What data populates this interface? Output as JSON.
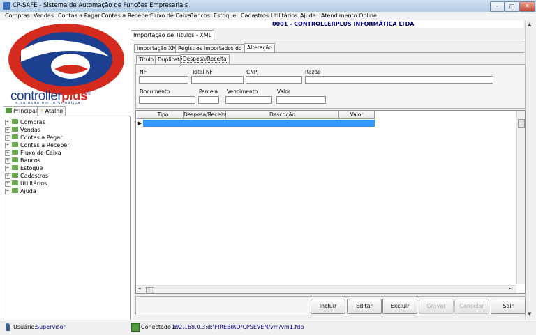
{
  "window": {
    "title": "CP-SAFE  -  Sistema de Automação de Funções Empresariais",
    "min": "–",
    "max": "▢",
    "close": "✕"
  },
  "menu": [
    "Compras",
    "Vendas",
    "Contas a Pagar",
    "Contas a Receber",
    "Fluxo de Caixa",
    "Bancos",
    "Estoque",
    "Cadastros",
    "Utilitários",
    "Ajuda",
    "Atendimento Online"
  ],
  "company": "0001 - CONTROLLERPLUS INFORMÁTICA LTDA",
  "logo": {
    "brand_a": "controller",
    "brand_b": "plus",
    "registered": "®",
    "tagline": "a solução em informática"
  },
  "nav_tabs": {
    "principal": "Principal",
    "atalho": "Atalho"
  },
  "tree": [
    "Compras",
    "Vendas",
    "Contas a Pagar",
    "Contas a Receber",
    "Fluxo de Caixa",
    "Bancos",
    "Estoque",
    "Cadastros",
    "Utilitários",
    "Ajuda"
  ],
  "doc_tab": "Importação de Títulos - XML",
  "tabs_level1": [
    "Importação XML",
    "Registros Importados do XML",
    "Alteração"
  ],
  "tabs_level2": [
    "Título",
    "Duplicata",
    "Despesa/Receita"
  ],
  "form": {
    "nf": "NF",
    "total_nf": "Total NF",
    "cnpj": "CNPJ",
    "razao": "Razão",
    "documento": "Documento",
    "parcela": "Parcela",
    "vencimento": "Vencimento",
    "valor": "Valor"
  },
  "grid": {
    "columns": [
      "Tipo",
      "Despesa/Receita",
      "Descrição",
      "Valor"
    ],
    "row_marker": "▶"
  },
  "buttons": {
    "incluir": "Incluir",
    "editar": "Editar",
    "excluir": "Excluir",
    "gravar": "Gravar",
    "cancelar": "Cancelar",
    "sair": "Sair"
  },
  "status": {
    "user_label": "Usuário:",
    "user": "Supervisor",
    "conn_label": "Conectado à",
    "conn": "192.168.0.3:d:\\FIREBIRD/CPSEVEN/vm/vm1.fdb"
  },
  "colors": {
    "selection": "#3399ff",
    "company_text": "#000080",
    "logo_red": "#d52b1e",
    "logo_blue": "#1d3f8f"
  }
}
